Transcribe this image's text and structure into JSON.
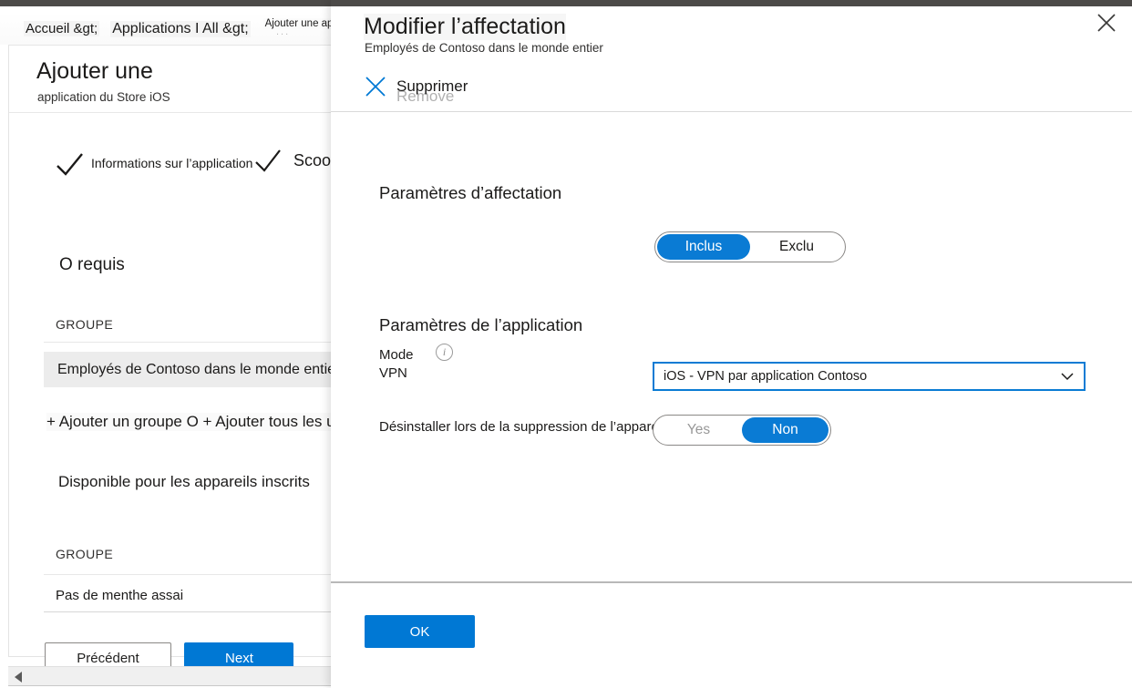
{
  "colors": {
    "accent_blue": "#0078d4",
    "toggle_blue": "#0a7bd4",
    "top_band": "#4c4a48",
    "row_highlight": "#ececec"
  },
  "background_page": {
    "breadcrumb": {
      "item1": "Accueil &gt;",
      "item2": "Applications I All &gt;",
      "item3": "Ajouter une application",
      "ghost": "..."
    },
    "title": "Ajouter une",
    "subtitle": "application du Store iOS",
    "step": {
      "label": "Informations sur l’application",
      "label2": "Scoop",
      "check_icon": "check-icon"
    },
    "required_section": {
      "heading": "O requis",
      "group_header": "GROUPE",
      "group_row": "Employés de Contoso dans le monde entier",
      "add_links": "+ Ajouter un groupe O + Ajouter tous les utilisateurs O +"
    },
    "available_section": {
      "heading": "Disponible pour les appareils inscrits",
      "group_header": "GROUPE",
      "group_row": "Pas de menthe assai"
    },
    "buttons": {
      "previous": "Précédent",
      "next": "Next"
    },
    "scrollbar": {
      "left_arrow_icon": "caret-left-icon"
    }
  },
  "blade": {
    "title": "Modifier l’affectation",
    "subtitle": "Employés de Contoso dans le monde entier",
    "close_icon": "close-icon",
    "command_bar": {
      "remove_label": "Supprimer",
      "remove_ghost_label": "Remove",
      "remove_icon": "x-icon"
    },
    "assignment_settings": {
      "section_title": "Paramètres d’affectation",
      "mode": {
        "label": "Mode",
        "info_icon": "info-icon",
        "options": [
          "Inclus",
          "Exclu"
        ],
        "selected": "Inclus"
      }
    },
    "app_settings": {
      "section_title": "Paramètres de l’application",
      "vpn": {
        "label": "VPN",
        "value": "iOS - VPN par application Contoso",
        "chevron_icon": "chevron-down-icon"
      },
      "uninstall": {
        "label": "Désinstaller lors de la suppression de l’appareil",
        "options": [
          "Yes",
          "Non"
        ],
        "selected": "Non"
      }
    },
    "footer": {
      "ok_label": "OK"
    }
  }
}
